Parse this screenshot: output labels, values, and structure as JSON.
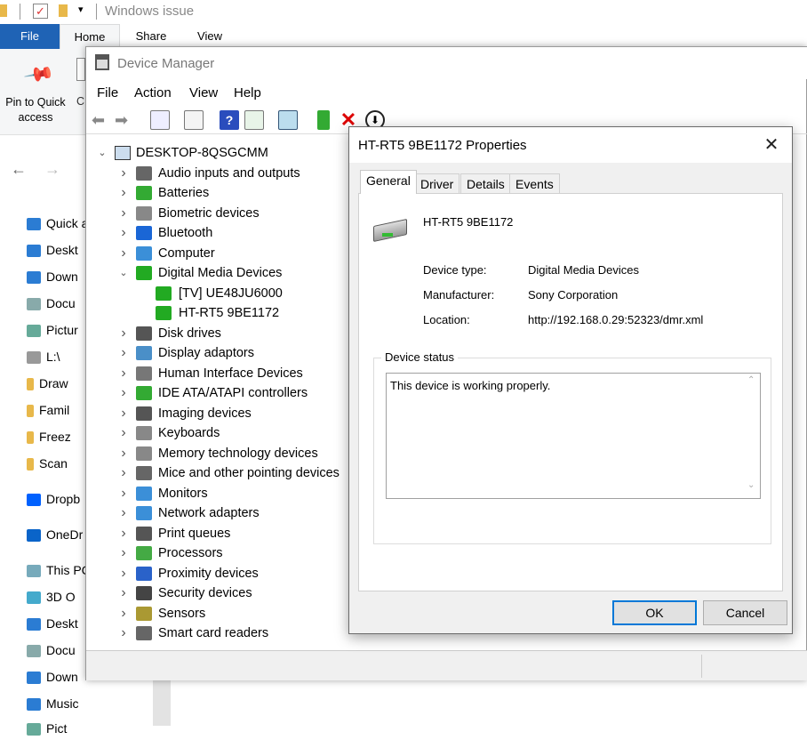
{
  "explorer": {
    "title": "Windows issue",
    "tabs": [
      "File",
      "Home",
      "Share",
      "View"
    ],
    "ribbon_pin_label": "Pin to Quick access",
    "nav": [
      {
        "label": "Quick a",
        "icon": "star-icon"
      },
      {
        "label": "Deskt",
        "icon": "desktop-icon"
      },
      {
        "label": "Down",
        "icon": "download-icon"
      },
      {
        "label": "Docu",
        "icon": "document-icon"
      },
      {
        "label": "Pictur",
        "icon": "pictures-icon"
      },
      {
        "label": "L:\\",
        "icon": "drive-icon"
      },
      {
        "label": "Draw",
        "icon": "folder-icon"
      },
      {
        "label": "Famil",
        "icon": "folder-icon"
      },
      {
        "label": "Freez",
        "icon": "folder-icon"
      },
      {
        "label": "Scan",
        "icon": "folder-icon"
      },
      {
        "label": "Dropb",
        "icon": "dropbox-icon"
      },
      {
        "label": "OneDr",
        "icon": "onedrive-icon"
      },
      {
        "label": "This PC",
        "icon": "pc-icon"
      },
      {
        "label": "3D O",
        "icon": "3d-objects-icon"
      },
      {
        "label": "Deskt",
        "icon": "desktop-icon"
      },
      {
        "label": "Docu",
        "icon": "document-icon"
      },
      {
        "label": "Down",
        "icon": "download-icon"
      },
      {
        "label": "Music",
        "icon": "music-icon"
      },
      {
        "label": "Pict",
        "icon": "pictures-icon"
      }
    ]
  },
  "devmgr": {
    "title": "Device Manager",
    "menu": [
      "File",
      "Action",
      "View",
      "Help"
    ],
    "root": "DESKTOP-8QSGCMM",
    "tree": [
      {
        "label": "Audio inputs and outputs",
        "expanded": false
      },
      {
        "label": "Batteries",
        "expanded": false
      },
      {
        "label": "Biometric devices",
        "expanded": false
      },
      {
        "label": "Bluetooth",
        "expanded": false
      },
      {
        "label": "Computer",
        "expanded": false
      },
      {
        "label": "Digital Media Devices",
        "expanded": true
      },
      {
        "label": "[TV] UE48JU6000",
        "child": true
      },
      {
        "label": "HT-RT5 9BE1172",
        "child": true
      },
      {
        "label": "Disk drives",
        "expanded": false
      },
      {
        "label": "Display adaptors",
        "expanded": false
      },
      {
        "label": "Human Interface Devices",
        "expanded": false
      },
      {
        "label": "IDE ATA/ATAPI controllers",
        "expanded": false
      },
      {
        "label": "Imaging devices",
        "expanded": false
      },
      {
        "label": "Keyboards",
        "expanded": false
      },
      {
        "label": "Memory technology devices",
        "expanded": false
      },
      {
        "label": "Mice and other pointing devices",
        "expanded": false
      },
      {
        "label": "Monitors",
        "expanded": false
      },
      {
        "label": "Network adapters",
        "expanded": false
      },
      {
        "label": "Print queues",
        "expanded": false
      },
      {
        "label": "Processors",
        "expanded": false
      },
      {
        "label": "Proximity devices",
        "expanded": false
      },
      {
        "label": "Security devices",
        "expanded": false
      },
      {
        "label": "Sensors",
        "expanded": false
      },
      {
        "label": "Smart card readers",
        "expanded": false
      }
    ]
  },
  "props": {
    "title": "HT-RT5 9BE1172 Properties",
    "tabs": [
      "General",
      "Driver",
      "Details",
      "Events"
    ],
    "device_name": "HT-RT5 9BE1172",
    "device_type_label": "Device type:",
    "device_type": "Digital Media Devices",
    "manufacturer_label": "Manufacturer:",
    "manufacturer": "Sony Corporation",
    "location_label": "Location:",
    "location": "http://192.168.0.29:52323/dmr.xml",
    "status_legend": "Device status",
    "status_text": "This device is working properly.",
    "ok": "OK",
    "cancel": "Cancel"
  },
  "colors": {
    "accent": "#1f63b5",
    "close_red": "#e81123"
  }
}
